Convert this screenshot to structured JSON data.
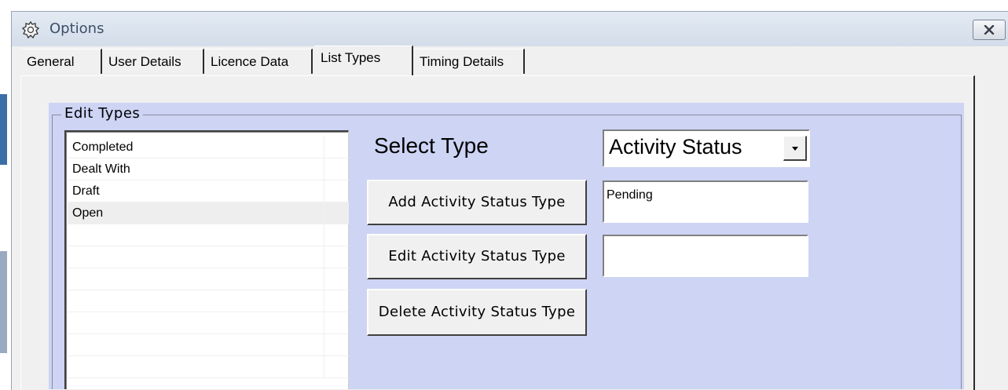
{
  "window": {
    "title": "Options",
    "icon": "gear-puzzle-icon",
    "close_icon": "close-icon"
  },
  "tabs": [
    {
      "label": "General",
      "active": false
    },
    {
      "label": "User Details",
      "active": false
    },
    {
      "label": "Licence Data",
      "active": false
    },
    {
      "label": "List Types",
      "active": true
    },
    {
      "label": "Timing Details",
      "active": false
    }
  ],
  "group": {
    "title": "Edit Types",
    "list_items": [
      "Completed",
      "Dealt With",
      "Draft",
      "Open"
    ],
    "selected_item": "Open",
    "select_label": "Select Type",
    "select_value": "Activity Status",
    "add_button": "Add Activity Status Type",
    "add_value": "Pending",
    "edit_button": "Edit Activity Status Type",
    "edit_value": "",
    "delete_button": "Delete Activity Status Type"
  },
  "colors": {
    "group_background": "#cdd4f4",
    "titlebar": "#dbe3ee",
    "title_text": "#3d4e68"
  }
}
